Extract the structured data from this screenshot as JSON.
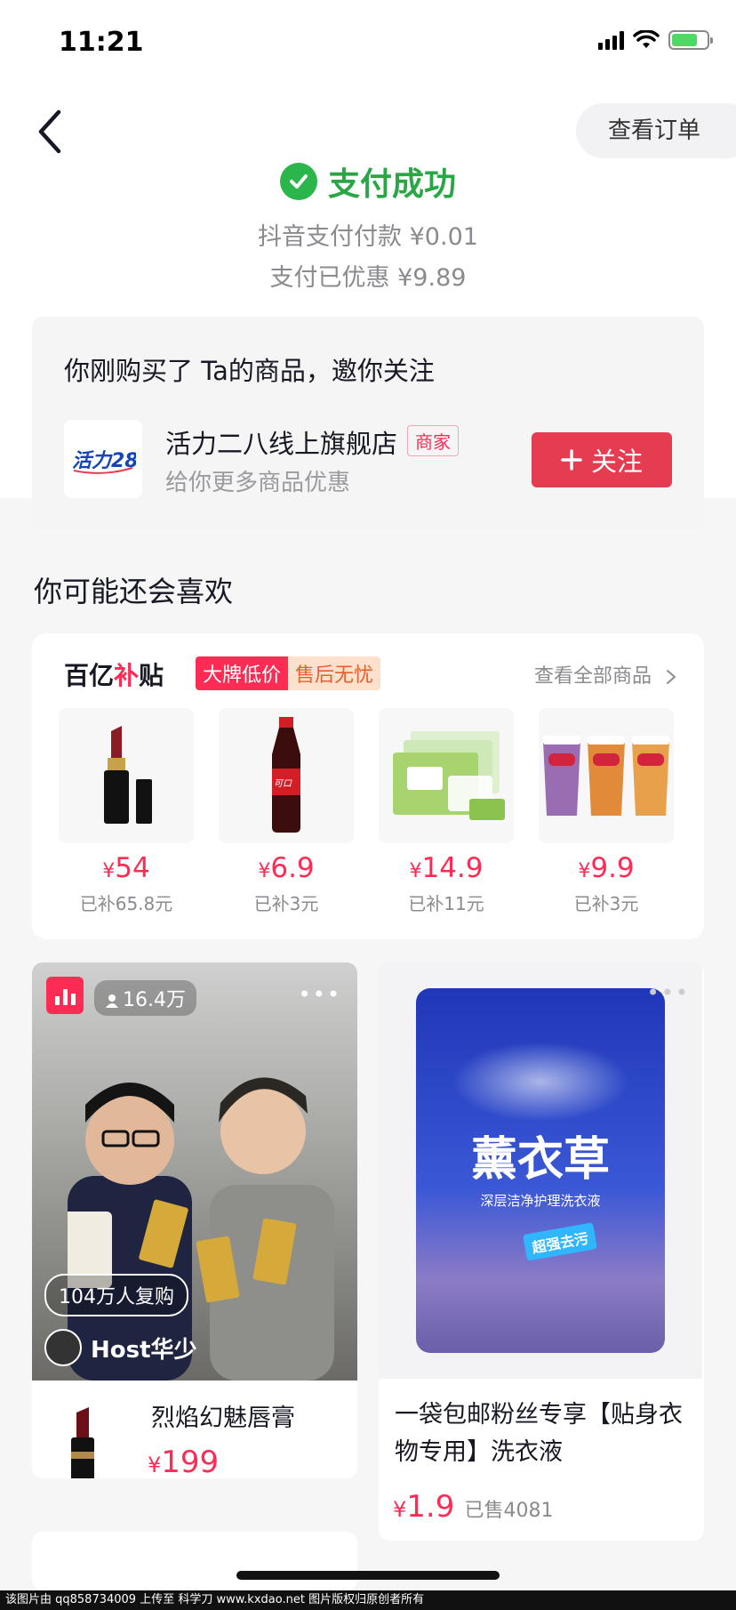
{
  "status_bar": {
    "time": "11:21"
  },
  "header": {
    "order_button": "查看订单"
  },
  "payment": {
    "title": "支付成功",
    "paid_line": "抖音支付付款 ¥0.01",
    "discount_line": "支付已优惠 ¥9.89"
  },
  "follow_card": {
    "title": "你刚购买了 Ta的商品，邀你关注",
    "shop_name": "活力二八线上旗舰店",
    "merchant_tag": "商家",
    "subtitle": "给你更多商品优惠",
    "follow_button": "关注"
  },
  "recommend": {
    "title": "你可能还会喜欢"
  },
  "subsidy": {
    "brand_a": "百亿",
    "brand_b": "补",
    "brand_c": "贴",
    "tag_low_price": "大牌低价",
    "tag_after_sale": "售后无忧",
    "view_all": "查看全部商品",
    "items": [
      {
        "currency": "¥",
        "price": "54",
        "saved": "已补65.8元",
        "icon": "lipstick"
      },
      {
        "currency": "¥",
        "price": "6.9",
        "saved": "已补3元",
        "icon": "cola-bottle"
      },
      {
        "currency": "¥",
        "price": "14.9",
        "saved": "已补11元",
        "icon": "tissue-pack"
      },
      {
        "currency": "¥",
        "price": "9.9",
        "saved": "已补3元",
        "icon": "milk-tea-cups"
      }
    ]
  },
  "feed": {
    "live_card": {
      "viewers": "16.4万",
      "rebuy": "104万人复购",
      "host": "Host华少",
      "product_title": "烈焰幻魅唇膏",
      "currency": "¥",
      "price": "199"
    },
    "product_card": {
      "pack_brand": "薰衣草",
      "pack_sub": "深层洁净护理洗衣液",
      "pack_stamp": "超强去污",
      "title": "一袋包邮粉丝专享【贴身衣物专用】洗衣液",
      "currency": "¥",
      "price": "1.9",
      "sold": "已售4081"
    }
  },
  "watermark": "该图片由 qq858734009 上传至 科学刀 www.kxdao.net 图片版权归原创者所有",
  "colors": {
    "accent": "#fe2c55",
    "success": "#2aa647",
    "follow_button": "#e63c52"
  }
}
